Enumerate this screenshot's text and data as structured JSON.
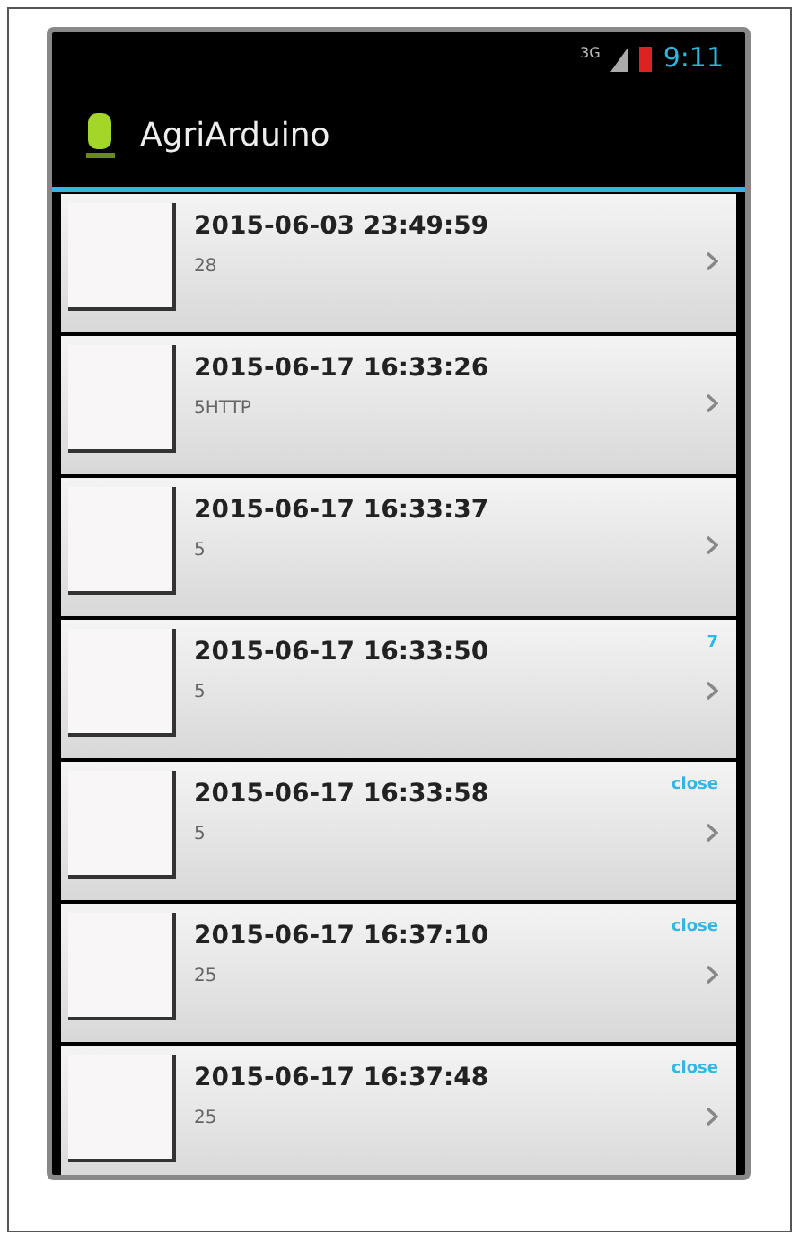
{
  "status_bar": {
    "network": "3G",
    "time": "9:11"
  },
  "action_bar": {
    "title": "AgriArduino"
  },
  "rows": [
    {
      "title": "2015-06-03 23:49:59",
      "subtitle": "28"
    },
    {
      "title": "2015-06-17 16:33:26",
      "subtitle": "5HTTP"
    },
    {
      "title": "2015-06-17 16:33:37",
      "subtitle": "5"
    },
    {
      "title": "2015-06-17 16:33:50",
      "subtitle": "5",
      "tag": "7"
    },
    {
      "title": "2015-06-17 16:33:58",
      "subtitle": "5",
      "tag": "close"
    },
    {
      "title": "2015-06-17 16:37:10",
      "subtitle": "25",
      "tag": "close"
    },
    {
      "title": "2015-06-17 16:37:48",
      "subtitle": "25",
      "tag": "close"
    }
  ]
}
